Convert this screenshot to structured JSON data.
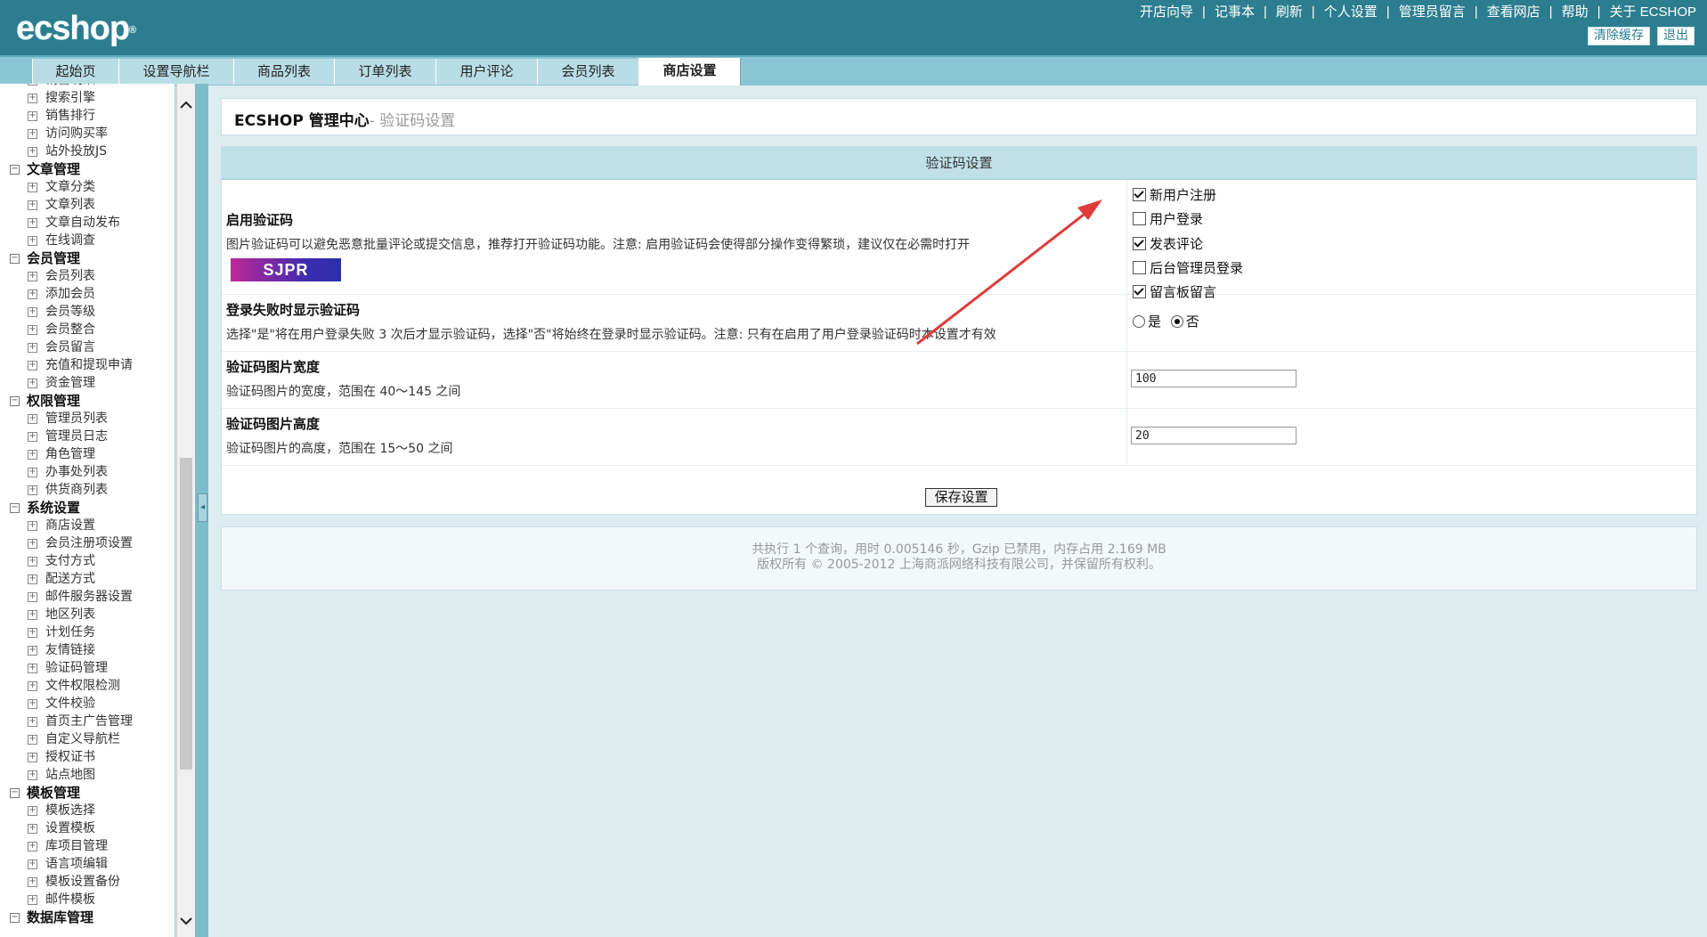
{
  "header": {
    "logo_text": "ecshop",
    "logo_mark": "®",
    "top_links": [
      "开店向导",
      "记事本",
      "刷新",
      "个人设置",
      "管理员留言",
      "查看网店",
      "帮助",
      "关于 ECSHOP"
    ],
    "buttons": {
      "clear_cache": "清除缓存",
      "logout": "退出"
    }
  },
  "tabs": [
    {
      "label": "起始页"
    },
    {
      "label": "设置导航栏"
    },
    {
      "label": "商品列表"
    },
    {
      "label": "订单列表"
    },
    {
      "label": "用户评论"
    },
    {
      "label": "会员列表"
    },
    {
      "label": "商店设置"
    }
  ],
  "sidebar": {
    "items": [
      {
        "type": "item",
        "label": "销售明细"
      },
      {
        "type": "item",
        "label": "搜索引擎"
      },
      {
        "type": "item",
        "label": "销售排行"
      },
      {
        "type": "item",
        "label": "访问购买率"
      },
      {
        "type": "item",
        "label": "站外投放JS"
      },
      {
        "type": "group",
        "label": "文章管理"
      },
      {
        "type": "item",
        "label": "文章分类"
      },
      {
        "type": "item",
        "label": "文章列表"
      },
      {
        "type": "item",
        "label": "文章自动发布"
      },
      {
        "type": "item",
        "label": "在线调查"
      },
      {
        "type": "group",
        "label": "会员管理"
      },
      {
        "type": "item",
        "label": "会员列表"
      },
      {
        "type": "item",
        "label": "添加会员"
      },
      {
        "type": "item",
        "label": "会员等级"
      },
      {
        "type": "item",
        "label": "会员整合"
      },
      {
        "type": "item",
        "label": "会员留言"
      },
      {
        "type": "item",
        "label": "充值和提现申请"
      },
      {
        "type": "item",
        "label": "资金管理"
      },
      {
        "type": "group",
        "label": "权限管理"
      },
      {
        "type": "item",
        "label": "管理员列表"
      },
      {
        "type": "item",
        "label": "管理员日志"
      },
      {
        "type": "item",
        "label": "角色管理"
      },
      {
        "type": "item",
        "label": "办事处列表"
      },
      {
        "type": "item",
        "label": "供货商列表"
      },
      {
        "type": "group",
        "label": "系统设置"
      },
      {
        "type": "item",
        "label": "商店设置"
      },
      {
        "type": "item",
        "label": "会员注册项设置"
      },
      {
        "type": "item",
        "label": "支付方式"
      },
      {
        "type": "item",
        "label": "配送方式"
      },
      {
        "type": "item",
        "label": "邮件服务器设置"
      },
      {
        "type": "item",
        "label": "地区列表"
      },
      {
        "type": "item",
        "label": "计划任务"
      },
      {
        "type": "item",
        "label": "友情链接"
      },
      {
        "type": "item",
        "label": "验证码管理"
      },
      {
        "type": "item",
        "label": "文件权限检测"
      },
      {
        "type": "item",
        "label": "文件校验"
      },
      {
        "type": "item",
        "label": "首页主广告管理"
      },
      {
        "type": "item",
        "label": "自定义导航栏"
      },
      {
        "type": "item",
        "label": "授权证书"
      },
      {
        "type": "item",
        "label": "站点地图"
      },
      {
        "type": "group",
        "label": "模板管理"
      },
      {
        "type": "item",
        "label": "模板选择"
      },
      {
        "type": "item",
        "label": "设置模板"
      },
      {
        "type": "item",
        "label": "库项目管理"
      },
      {
        "type": "item",
        "label": "语言项编辑"
      },
      {
        "type": "item",
        "label": "模板设置备份"
      },
      {
        "type": "item",
        "label": "邮件模板"
      },
      {
        "type": "group",
        "label": "数据库管理"
      }
    ]
  },
  "page": {
    "title": "ECSHOP 管理中心",
    "subtitle": "- 验证码设置"
  },
  "form": {
    "header": "验证码设置",
    "enable": {
      "label": "启用验证码",
      "note": "图片验证码可以避免恶意批量评论或提交信息，推荐打开验证码功能。注意: 启用验证码会使得部分操作变得繁琐，建议仅在必需时打开",
      "captcha_text": "SJPR",
      "options": [
        {
          "label": "新用户注册",
          "checked": true
        },
        {
          "label": "用户登录",
          "checked": false
        },
        {
          "label": "发表评论",
          "checked": true
        },
        {
          "label": "后台管理员登录",
          "checked": false
        },
        {
          "label": "留言板留言",
          "checked": true
        }
      ]
    },
    "login_fail": {
      "label": "登录失败时显示验证码",
      "note": "选择\"是\"将在用户登录失败 3 次后才显示验证码，选择\"否\"将始终在登录时显示验证码。注意: 只有在启用了用户登录验证码时本设置才有效",
      "yes": "是",
      "no": "否",
      "selected": "no"
    },
    "width": {
      "label": "验证码图片宽度",
      "note": "验证码图片的宽度，范围在 40～145 之间",
      "value": "100"
    },
    "height": {
      "label": "验证码图片高度",
      "note": "验证码图片的高度，范围在 15～50 之间",
      "value": "20"
    },
    "save_label": "保存设置"
  },
  "footer": {
    "line1": "共执行 1 个查询，用时 0.005146 秒，Gzip 已禁用，内存占用 2.169 MB",
    "line2": "版权所有 © 2005-2012 上海商派网络科技有限公司，并保留所有权利。"
  },
  "colors": {
    "header_bg": "#2b7d8f",
    "tab_bar": "#8ac6d3",
    "page_bg": "#dcecef",
    "form_header": "#bfe0e8",
    "annotation_arrow": "#e03a3a"
  },
  "icons": {
    "sidebar_collapse": "minus-box-icon",
    "sidebar_expand": "plus-box-icon",
    "scroll_up": "chevron-up-icon",
    "scroll_down": "chevron-down-icon",
    "splitter": "chevron-left-icon"
  }
}
